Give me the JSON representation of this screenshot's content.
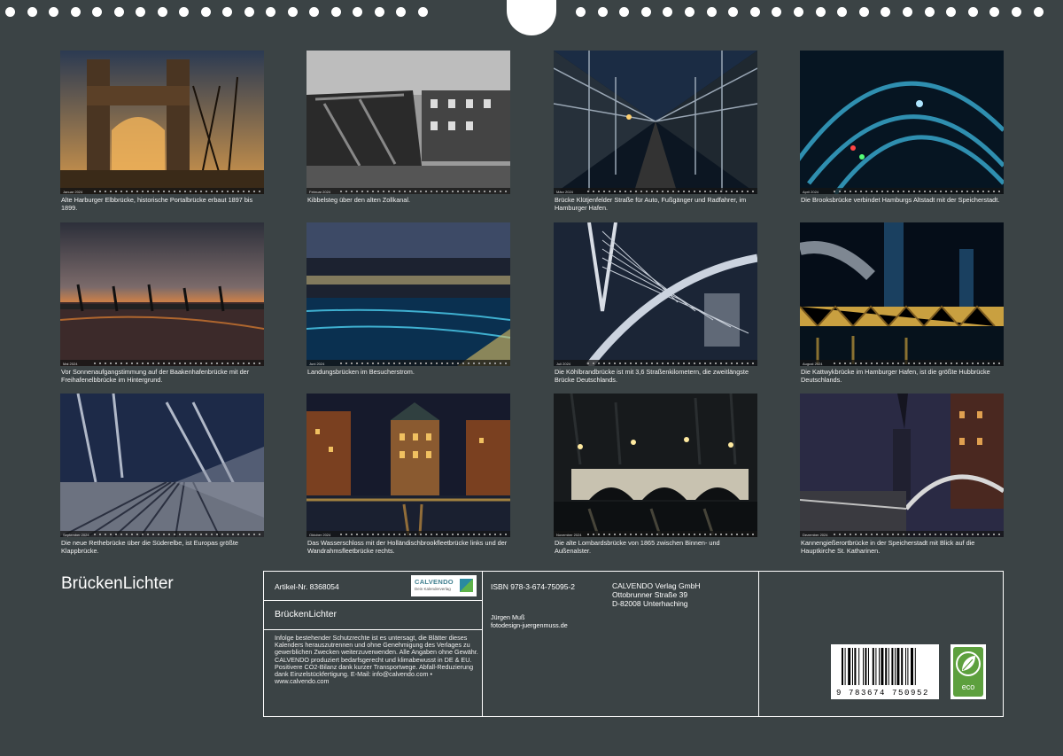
{
  "calendar_title": "BrückenLichter",
  "months": [
    {
      "strip_label": "Januar 2024",
      "caption": "Alte Harburger Elbbrücke, historische Portalbrücke erbaut 1897 bis 1899."
    },
    {
      "strip_label": "Februar 2024",
      "caption": "Kibbelsteg über den alten Zollkanal."
    },
    {
      "strip_label": "März 2024",
      "caption": "Brücke Klütjenfelder Straße für Auto, Fußgänger und Radfahrer, im Hamburger Hafen."
    },
    {
      "strip_label": "April 2024",
      "caption": "Die Brooksbrücke verbindet Hamburgs Altstadt mit der Speicherstadt."
    },
    {
      "strip_label": "Mai 2024",
      "caption": "Vor Sonnenaufgangstimmung auf der Baakenhafenbrücke mit der Freihafenelbbrücke im Hintergrund."
    },
    {
      "strip_label": "Juni 2024",
      "caption": "Landungsbrücken im Besucherstrom."
    },
    {
      "strip_label": "Juli 2024",
      "caption": "Die Köhlbrandbrücke ist mit 3,6 Straßenkilometern, die zweitlängste Brücke Deutschlands."
    },
    {
      "strip_label": "August 2024",
      "caption": "Die Kattwykbrücke im Hamburger Hafen, ist die größte Hubbrücke Deutschlands."
    },
    {
      "strip_label": "September 2024",
      "caption": "Die neue Rethebrücke über die Süderelbe, ist Europas größte Klappbrücke."
    },
    {
      "strip_label": "Oktober 2024",
      "caption": "Das Wasserschloss mit der Holländischbrookfleetbrücke links und der Wandrahmsfleetbrücke rechts."
    },
    {
      "strip_label": "November 2024",
      "caption": "Die alte Lombardsbrücke von 1865 zwischen Binnen- und Außenalster."
    },
    {
      "strip_label": "Dezember 2024",
      "caption": "Kannengießerortbrücke in der Speicherstadt mit Blick auf die Hauptkirche St. Katharinen."
    }
  ],
  "info": {
    "article": "Artikel-Nr. 8368054",
    "logo": "CALVENDO",
    "logo_sub": "Dein Kalenderverlag",
    "product_title": "BrückenLichter",
    "legal": "Infolge bestehender Schutzrechte ist es untersagt, die Blätter dieses Kalenders herauszutrennen und ohne Genehmigung des Verlages zu gewerblichen Zwecken weiterzuverwenden. Alle Angaben ohne Gewähr. CALVENDO produziert bedarfsgerecht und klimabewusst in DE & EU. Positivere CO2-Bilanz dank kurzer Transportwege. Abfall-Reduzierung dank Einzelstückfertigung. E-Mail: info@calvendo.com • www.calvendo.com",
    "isbn": "ISBN 978-3-674-75095-2",
    "publisher_name": "CALVENDO Verlag GmbH",
    "publisher_street": "Ottobrunner Straße 39",
    "publisher_city": "D-82008 Unterhaching",
    "author": "Jürgen Muß",
    "author_web": "fotodesign-juergenmuss.de",
    "barcode_number": "9 783674 750952",
    "eco_label": "eco"
  }
}
